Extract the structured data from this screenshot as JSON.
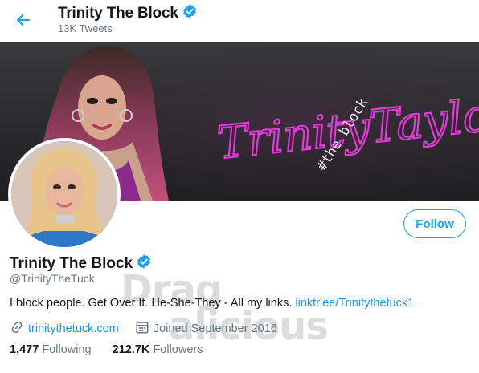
{
  "header": {
    "title": "Trinity The Block",
    "tweet_count": "13K Tweets"
  },
  "banner": {
    "neon_text": "TrinityTaylor",
    "neon_tag": "#the block"
  },
  "profile": {
    "name": "Trinity The Block",
    "handle": "@TrinityTheTuck",
    "follow_label": "Follow",
    "bio_text": "I block people. Get Over It. He-She-They - All my links. ",
    "bio_link": "linktr.ee/Trinitythetuck1",
    "website": "trinitythetuck.com",
    "joined": "Joined September 2016",
    "following_count": "1,477",
    "following_label": "Following",
    "followers_count": "212.7K",
    "followers_label": "Followers"
  },
  "watermark": {
    "line1": "Drag",
    "line2": "alicious"
  },
  "colors": {
    "accent": "#1da1f2",
    "link": "#1b95e0",
    "muted": "#657786",
    "neon": "#e23ad6"
  },
  "icons": {
    "back": "back-arrow-icon",
    "verified": "verified-badge-icon",
    "link": "link-icon",
    "calendar": "calendar-icon"
  }
}
